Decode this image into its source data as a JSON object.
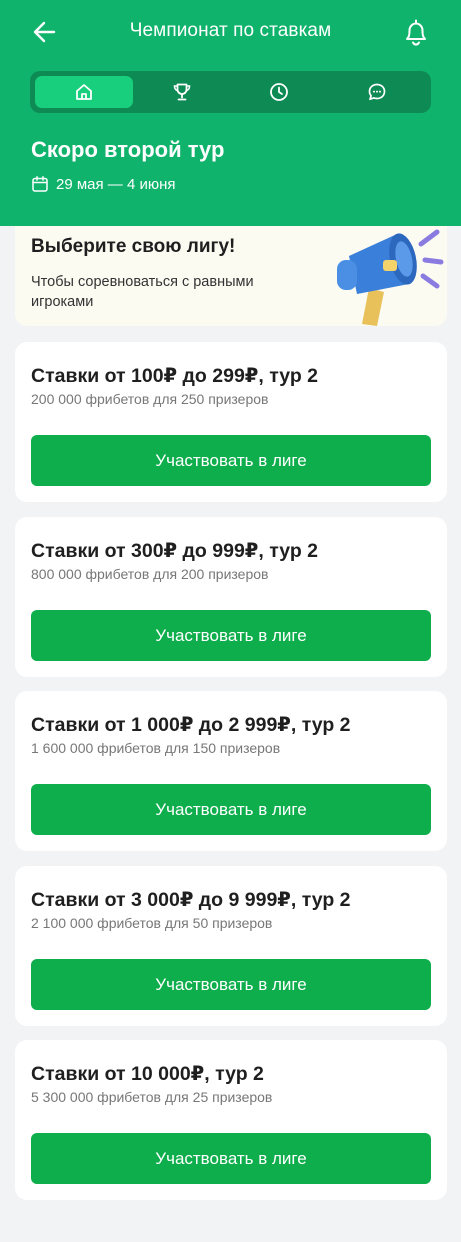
{
  "header": {
    "title": "Чемпионат по ставкам",
    "tabs": [
      {
        "icon": "home-icon",
        "active": true
      },
      {
        "icon": "trophy-icon",
        "active": false
      },
      {
        "icon": "clock-icon",
        "active": false
      },
      {
        "icon": "chat-icon",
        "active": false
      }
    ],
    "hero_title": "Скоро второй тур",
    "dates": "29 мая — 4 июня"
  },
  "promo": {
    "title": "Выберите свою лигу!",
    "subtitle": "Чтобы соревноваться с равными игроками"
  },
  "leagues": [
    {
      "title": "Ставки от 100₽ до 299₽, тур 2",
      "prize": "200 000 фрибетов для 250 призеров",
      "button": "Участвовать в лиге"
    },
    {
      "title": "Ставки от 300₽ до 999₽, тур 2",
      "prize": "800 000 фрибетов для 200 призеров",
      "button": "Участвовать в лиге"
    },
    {
      "title": "Ставки от 1 000₽ до 2 999₽, тур 2",
      "prize": "1 600 000 фрибетов для 150 призеров",
      "button": "Участвовать в лиге"
    },
    {
      "title": "Ставки от 3 000₽ до 9 999₽, тур 2",
      "prize": "2 100 000 фрибетов для 50 призеров",
      "button": "Участвовать в лиге"
    },
    {
      "title": "Ставки от 10 000₽, тур 2",
      "prize": "5 300 000 фрибетов для 25 призеров",
      "button": "Участвовать в лиге"
    }
  ],
  "colors": {
    "header_bg": "#10b36c",
    "tab_bar_bg": "#0e8a55",
    "tab_active_bg": "#18cf7d",
    "button_bg": "#0fae4c",
    "promo_bg": "#fcfbf2"
  }
}
